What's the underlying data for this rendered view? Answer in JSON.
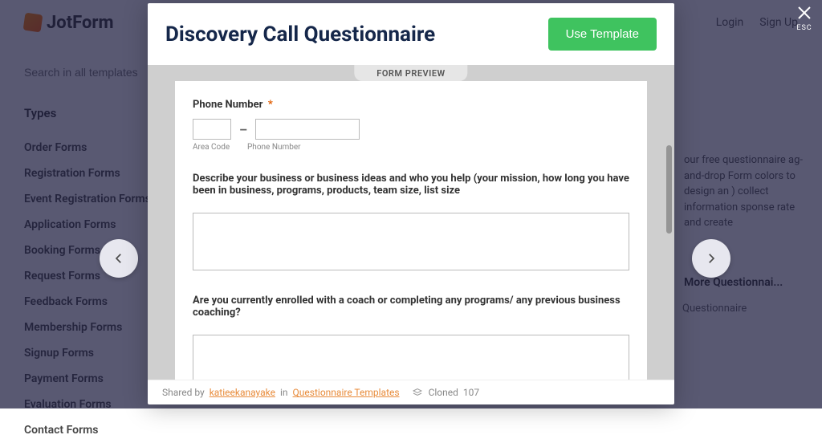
{
  "header": {
    "brand": "JotForm",
    "login": "Login",
    "signup": "Sign Up"
  },
  "search": {
    "placeholder": "Search in all templates"
  },
  "sidebar": {
    "heading": "Types",
    "items": [
      "Order Forms",
      "Registration Forms",
      "Event Registration Forms",
      "Application Forms",
      "Booking Forms",
      "Request Forms",
      "Feedback Forms",
      "Membership Forms",
      "Signup Forms",
      "Payment Forms",
      "Evaluation Forms",
      "Contact Forms"
    ]
  },
  "description": "our free questionnaire ag-and-drop Form colors to design an ) collect information sponse rate and create",
  "more_link": "More Questionnai...",
  "sub_link": "Questionnaire",
  "close": {
    "esc": "ESC"
  },
  "modal": {
    "title": "Discovery Call Questionnaire",
    "use_button": "Use Template",
    "preview_label": "FORM PREVIEW",
    "phone": {
      "label": "Phone Number",
      "required": "*",
      "dash": "–",
      "area_sub": "Area Code",
      "num_sub": "Phone Number"
    },
    "q1": "Describe your business or business ideas and who you help (your mission, how long you have been in business, programs, products, team size, list size",
    "q2": "Are you currently enrolled with a coach or completing any programs/ any previous business coaching?",
    "footer": {
      "shared": "Shared by",
      "author": "katieekanayake",
      "in": "in",
      "category": "Questionnaire Templates",
      "cloned": "Cloned",
      "count": "107"
    }
  }
}
